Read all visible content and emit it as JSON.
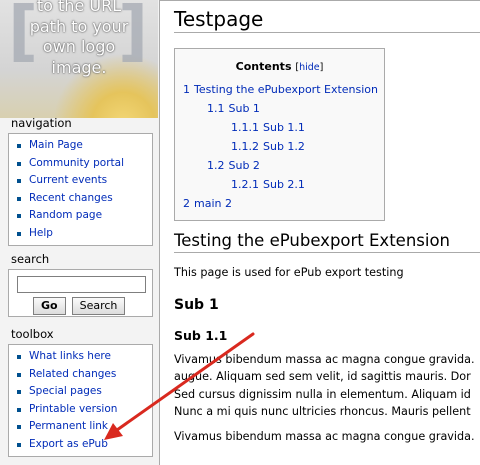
{
  "logo": {
    "lines": [
      "to the URL",
      "path to your",
      "own logo",
      "image."
    ]
  },
  "navigation": {
    "title": "navigation",
    "items": [
      "Main Page",
      "Community portal",
      "Current events",
      "Recent changes",
      "Random page",
      "Help"
    ]
  },
  "search": {
    "title": "search",
    "input_value": "",
    "go_label": "Go",
    "search_label": "Search"
  },
  "toolbox": {
    "title": "toolbox",
    "items": [
      "What links here",
      "Related changes",
      "Special pages",
      "Printable version",
      "Permanent link",
      "Export as ePub"
    ]
  },
  "page": {
    "title": "Testpage",
    "toc": {
      "title": "Contents",
      "hide_open": "[",
      "hide_label": "hide",
      "hide_close": "]",
      "entries": [
        {
          "num": "1",
          "text": "Testing the ePubexport Extension"
        },
        {
          "num": "1.1",
          "text": "Sub 1"
        },
        {
          "num": "1.1.1",
          "text": "Sub 1.1"
        },
        {
          "num": "1.1.2",
          "text": "Sub 1.2"
        },
        {
          "num": "1.2",
          "text": "Sub 2"
        },
        {
          "num": "1.2.1",
          "text": "Sub 2.1"
        },
        {
          "num": "2",
          "text": "main 2"
        }
      ]
    },
    "heading1": "Testing the ePubexport Extension",
    "intro": "This page is used for ePub export testing",
    "heading2": "Sub 1",
    "heading3": "Sub 1.1",
    "lorem_lines": [
      "Vivamus bibendum massa ac magna congue gravida.",
      "augue. Aliquam sed sem velit, id sagittis mauris. Dor",
      "Sed cursus dignissim nulla in elementum. Aliquam id",
      "Nunc a mi quis nunc ultricies rhoncus. Mauris pellent"
    ],
    "lorem2_line": "Vivamus bibendum massa ac magna congue gravida."
  },
  "colors": {
    "link": "#002bb8",
    "annotation_arrow": "#d9291f"
  }
}
